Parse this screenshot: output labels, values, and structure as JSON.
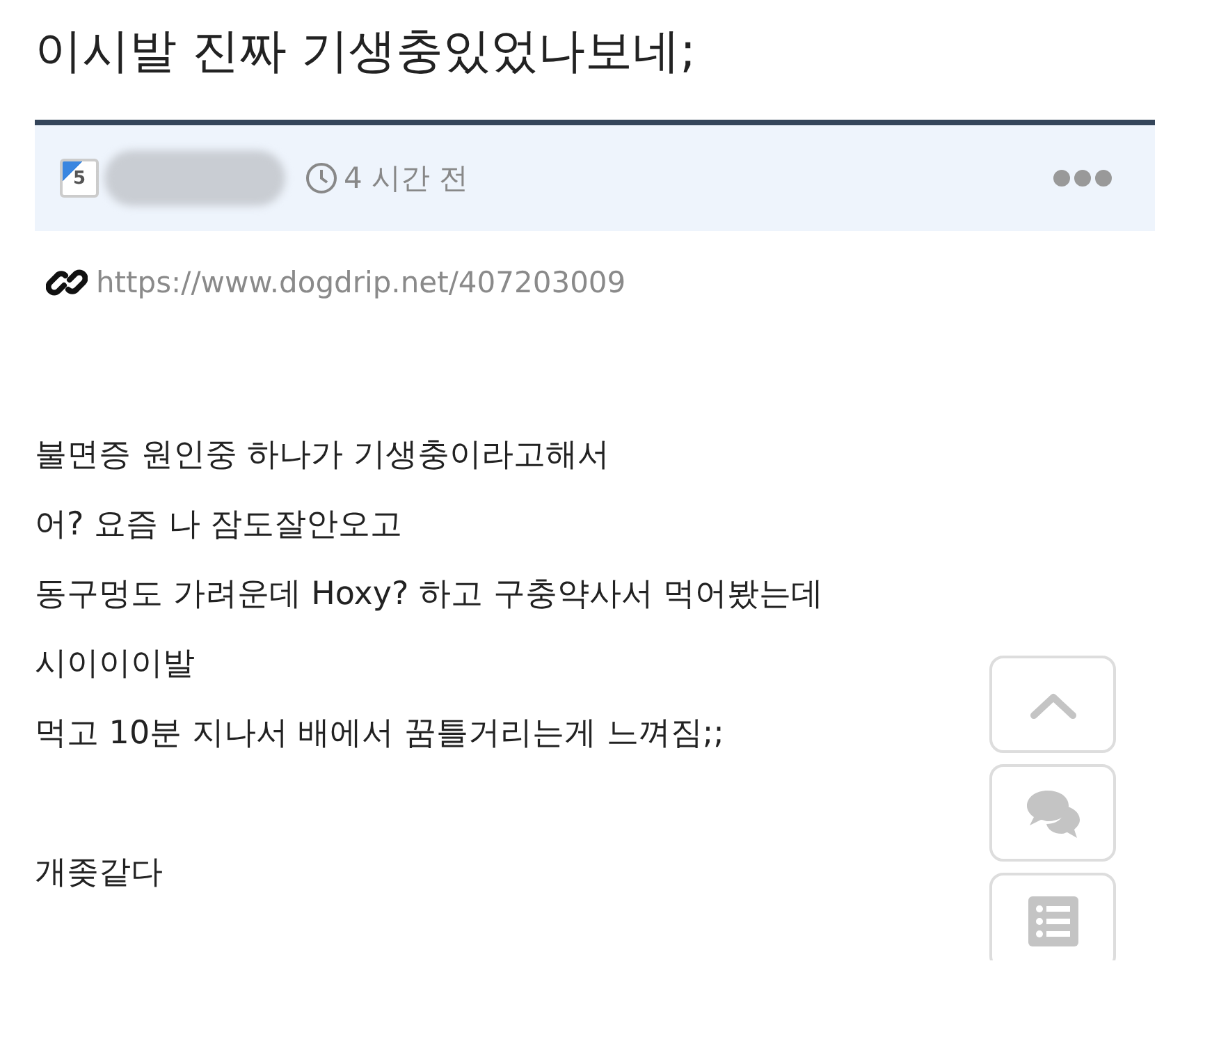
{
  "title": "이시발 진짜 기생충있었나보네;",
  "meta": {
    "level": "5",
    "time": "4 시간 전"
  },
  "link": "https://www.dogdrip.net/407203009",
  "body": [
    [
      "불면증 원인중 하나가 기생충이라고해서",
      "어? 요즘 나 잠도잘안오고",
      "동구멍도 가려운데 Hoxy? 하고 구충약사서 먹어봤는데",
      "시이이이발",
      "먹고 10분 지나서 배에서 꿈틀거리는게 느껴짐;;"
    ],
    [
      "개좆같다"
    ]
  ],
  "side_buttons": [
    {
      "kind": "top"
    },
    {
      "kind": "comments"
    },
    {
      "kind": "list"
    }
  ]
}
